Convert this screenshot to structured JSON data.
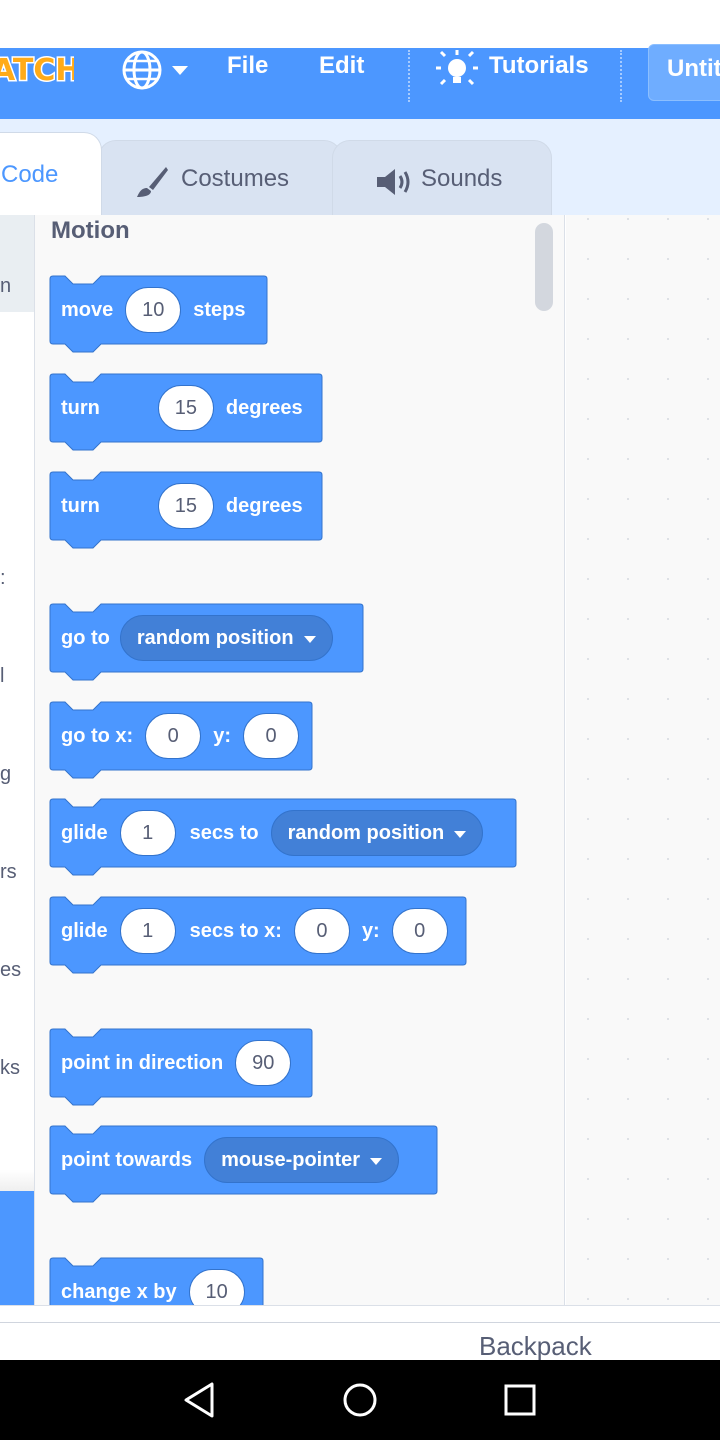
{
  "menubar": {
    "logo_text": "ATCH",
    "file_label": "File",
    "edit_label": "Edit",
    "tutorials_label": "Tutorials",
    "project_title": "Untit"
  },
  "tabs": [
    {
      "label": "Code",
      "icon": "code"
    },
    {
      "label": "Costumes",
      "icon": "paintbrush-icon"
    },
    {
      "label": "Sounds",
      "icon": "speaker-icon"
    }
  ],
  "categories_visible_fragments": [
    "n",
    ":",
    "l",
    "g",
    "rs",
    "es",
    "ks"
  ],
  "palette": {
    "title": "Motion",
    "blocks": {
      "move": {
        "pre": "move",
        "value": "10",
        "post": "steps"
      },
      "turn_right": {
        "pre": "turn",
        "value": "15",
        "post": "degrees",
        "icon": "rotate-right-icon"
      },
      "turn_left": {
        "pre": "turn",
        "value": "15",
        "post": "degrees",
        "icon": "rotate-left-icon"
      },
      "go_to": {
        "pre": "go to",
        "dropdown": "random position"
      },
      "go_to_xy": {
        "pre": "go to x:",
        "x": "0",
        "mid": "y:",
        "y": "0"
      },
      "glide_to": {
        "pre": "glide",
        "value": "1",
        "mid": "secs to",
        "dropdown": "random position"
      },
      "glide_xy": {
        "pre": "glide",
        "value": "1",
        "mid": "secs to x:",
        "x": "0",
        "mid2": "y:",
        "y": "0"
      },
      "point_direction": {
        "pre": "point in direction",
        "value": "90"
      },
      "point_towards": {
        "pre": "point towards",
        "dropdown": "mouse-pointer"
      },
      "change_x": {
        "pre": "change x by",
        "value": "10"
      }
    }
  },
  "backpack_label": "Backpack",
  "colors": {
    "menubar": "#4c97ff",
    "motion_block": "#4c97ff",
    "motion_block_border": "#3373cc",
    "palette_bg": "#f9f9f9",
    "tab_bg": "#e5f0ff"
  }
}
